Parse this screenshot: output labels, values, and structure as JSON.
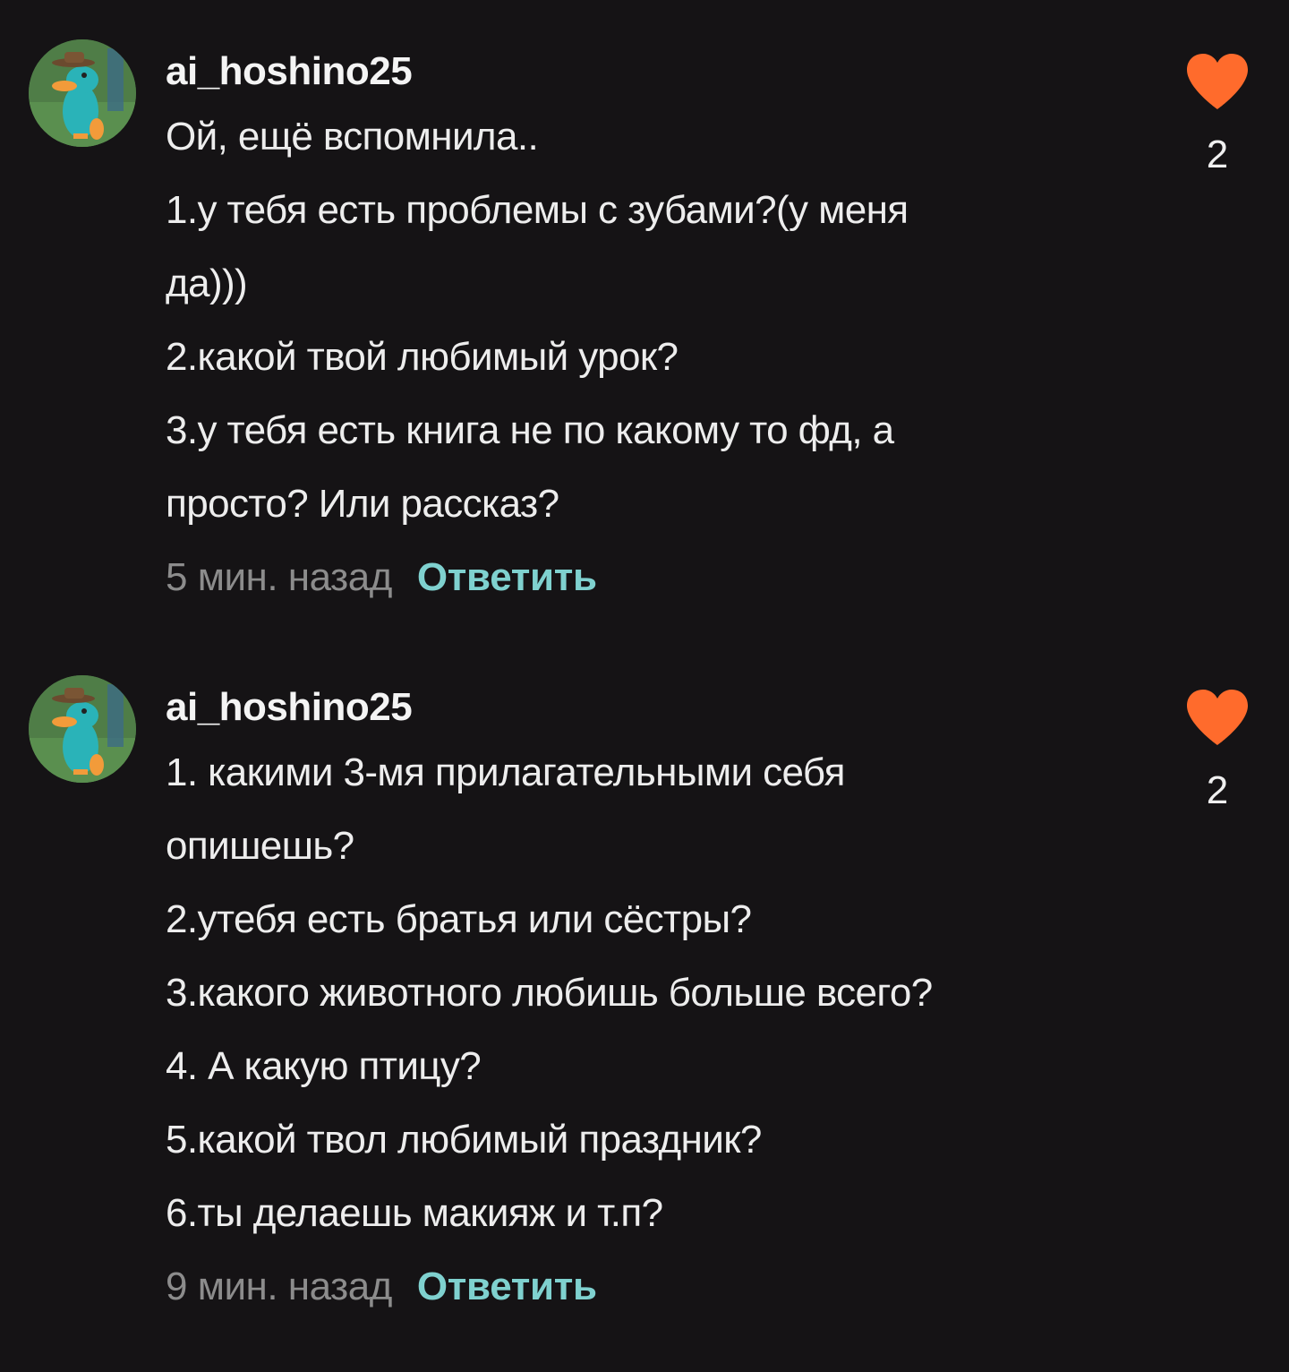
{
  "comments": [
    {
      "username": "ai_hoshino25",
      "lines": [
        "Ой, ещё вспомнила..",
        "1.у тебя есть проблемы с зубами?(у меня",
        "да)))",
        "2.какой твой любимый урок?",
        "3.у тебя есть книга не по какому то фд, а",
        "просто? Или рассказ?"
      ],
      "time": "5 мин. назад",
      "reply_label": "Ответить",
      "likes": "2"
    },
    {
      "username": "ai_hoshino25",
      "lines": [
        "1. какими 3-мя прилагательными себя",
        "опишешь?",
        "2.утебя есть братья или сёстры?",
        "3.какого животного любишь больше всего?",
        "4. А какую птицу?",
        "5.какой твол любимый праздник?",
        "6.ты делаешь макияж и т.п?"
      ],
      "time": "9 мин. назад",
      "reply_label": "Ответить",
      "likes": "2"
    }
  ],
  "colors": {
    "background": "#151315",
    "heart": "#ff6b2c",
    "reply": "#7fd1cf",
    "timestamp": "#8c8c8c"
  },
  "icons": {
    "like": "heart-icon",
    "avatar": "platypus-avatar"
  }
}
